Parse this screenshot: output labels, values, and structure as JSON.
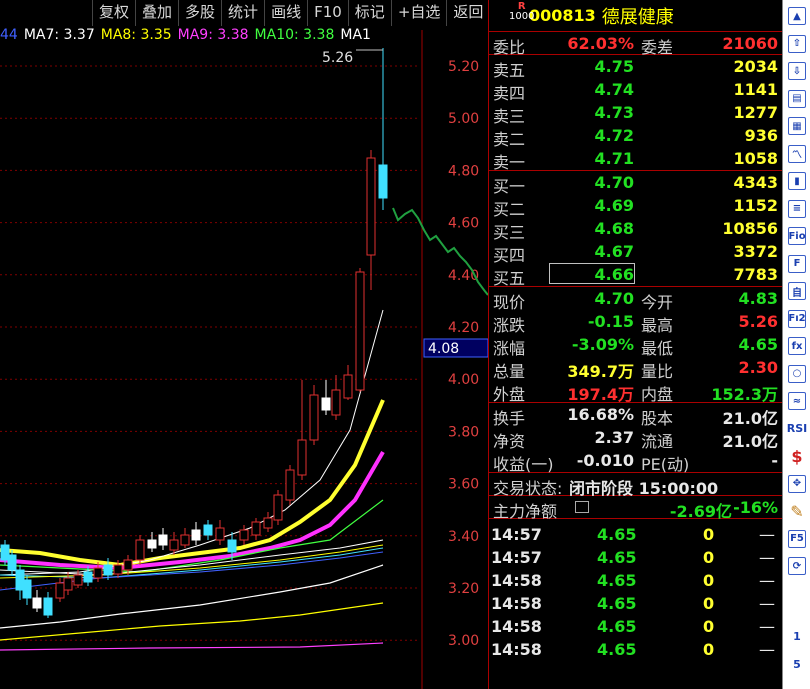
{
  "toolbar": [
    "复权",
    "叠加",
    "多股",
    "统计",
    "画线",
    "F10",
    "标记",
    "+自选",
    "返回"
  ],
  "ma_legend": [
    {
      "text": "44",
      "color": "#4060ff"
    },
    {
      "text": "MA7: 3.37",
      "color": "#ffffff"
    },
    {
      "text": "MA8: 3.35",
      "color": "#ffff00"
    },
    {
      "text": "MA9: 3.38",
      "color": "#ff40ff"
    },
    {
      "text": "MA10: 3.38",
      "color": "#40ff40"
    },
    {
      "text": "MA1",
      "color": "#ffffff"
    }
  ],
  "chart": {
    "high_label": "5.26",
    "current_price_label": "4.08",
    "y_ticks": [
      "5.20",
      "5.00",
      "4.80",
      "4.60",
      "4.40",
      "4.20",
      "4.00",
      "3.80",
      "3.60",
      "3.40",
      "3.20",
      "3.00"
    ]
  },
  "stock": {
    "badge_top": "R",
    "badge_bottom": "1000",
    "code": "000813",
    "name": "德展健康"
  },
  "bid_ratio": {
    "label1": "委比",
    "value1": "62.03%",
    "label2": "委差",
    "value2": "21060"
  },
  "sell": [
    {
      "label": "卖五",
      "price": "4.75",
      "vol": "2034"
    },
    {
      "label": "卖四",
      "price": "4.74",
      "vol": "1141"
    },
    {
      "label": "卖三",
      "price": "4.73",
      "vol": "1277"
    },
    {
      "label": "卖二",
      "price": "4.72",
      "vol": "936"
    },
    {
      "label": "卖一",
      "price": "4.71",
      "vol": "1058"
    }
  ],
  "buy": [
    {
      "label": "买一",
      "price": "4.70",
      "vol": "4343"
    },
    {
      "label": "买二",
      "price": "4.69",
      "vol": "1152"
    },
    {
      "label": "买三",
      "price": "4.68",
      "vol": "10856"
    },
    {
      "label": "买四",
      "price": "4.67",
      "vol": "3372"
    },
    {
      "label": "买五",
      "price": "4.66",
      "vol": "7783"
    }
  ],
  "stats": [
    {
      "l1": "现价",
      "v1": "4.70",
      "c1": "green",
      "l2": "今开",
      "v2": "4.83",
      "c2": "green"
    },
    {
      "l1": "涨跌",
      "v1": "-0.15",
      "c1": "green",
      "l2": "最高",
      "v2": "5.26",
      "c2": "red"
    },
    {
      "l1": "涨幅",
      "v1": "-3.09%",
      "c1": "green",
      "l2": "最低",
      "v2": "4.65",
      "c2": "green"
    },
    {
      "l1": "总量",
      "v1": "349.7万",
      "c1": "yellow",
      "l2": "量比",
      "v2": "2.30",
      "c2": "red"
    },
    {
      "l1": "外盘",
      "v1": "197.4万",
      "c1": "red",
      "l2": "内盘",
      "v2": "152.3万",
      "c2": "green"
    }
  ],
  "fund": [
    {
      "l1": "换手",
      "v1": "16.68%",
      "l2": "股本",
      "v2": "21.0亿"
    },
    {
      "l1": "净资",
      "v1": "2.37",
      "l2": "流通",
      "v2": "21.0亿"
    },
    {
      "l1": "收益(一)",
      "v1": "-0.010",
      "l2": "PE(动)",
      "v2": "-"
    }
  ],
  "status": {
    "label": "交易状态:",
    "value": "闭市阶段 15:00:00"
  },
  "main_net": {
    "label": "主力净额",
    "value": "-2.69亿",
    "pct": "-16%"
  },
  "ticks": [
    {
      "time": "14:57",
      "price": "4.65",
      "vol": "0",
      "flag": "—"
    },
    {
      "time": "14:57",
      "price": "4.65",
      "vol": "0",
      "flag": "—"
    },
    {
      "time": "14:58",
      "price": "4.65",
      "vol": "0",
      "flag": "—"
    },
    {
      "time": "14:58",
      "price": "4.65",
      "vol": "0",
      "flag": "—"
    },
    {
      "time": "14:58",
      "price": "4.65",
      "vol": "0",
      "flag": "—"
    },
    {
      "time": "14:58",
      "price": "4.65",
      "vol": "0",
      "flag": "—"
    }
  ],
  "right_tools": [
    "up-arrow-icon",
    "up-outline-icon",
    "down-outline-icon",
    "report-icon",
    "grid-icon",
    "line-chart-icon",
    "candle-icon",
    "info-icon",
    "f10-icon",
    "index-icon",
    "self-icon",
    "f12-icon",
    "fx-icon",
    "circle-icon",
    "wave-icon",
    "rsi-icon",
    "dollar-icon",
    "move-icon",
    "pencil-icon",
    "f5-icon",
    "refresh-icon"
  ],
  "right_labels": {
    "rsi": "RSI",
    "f5": "F5",
    "fio": "Fio",
    "f12": "Fı2",
    "n1": "1",
    "n5": "5"
  }
}
